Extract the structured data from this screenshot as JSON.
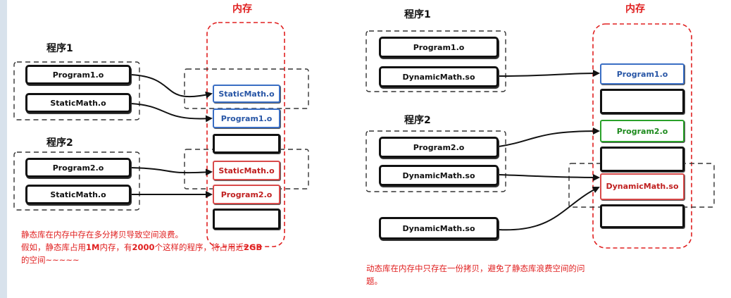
{
  "left": {
    "program1_label": "程序1",
    "program2_label": "程序2",
    "memory_title": "内存",
    "p1_files": [
      "Program1.o",
      "StaticMath.o"
    ],
    "p2_files": [
      "Program2.o",
      "StaticMath.o"
    ],
    "memory_blocks": [
      "StaticMath.o",
      "Program1.o",
      "",
      "StaticMath.o",
      "Program2.o",
      ""
    ],
    "note_line1": "静态库在内存中存在多分拷贝导致空间浪费。",
    "note_line2_a": "假如，静态库占用",
    "note_line2_b": "1M",
    "note_line2_c": "内存，有",
    "note_line2_d": "2000",
    "note_line2_e": "个这样的程序，将占用近",
    "note_line2_f": "2GB",
    "note_line3": "的空间~~~~~"
  },
  "right": {
    "program1_label": "程序1",
    "program2_label": "程序2",
    "memory_title": "内存",
    "p1_files": [
      "Program1.o",
      "DynamicMath.so"
    ],
    "p2_files": [
      "Program2.o",
      "DynamicMath.so"
    ],
    "shared_file": "DynamicMath.so",
    "memory_blocks": [
      "Program1.o",
      "",
      "Program2.o",
      "",
      "DynamicMath.so",
      ""
    ],
    "note_line1": "动态库在内存中只存在一份拷贝，避免了静态库浪费空间的问",
    "note_line2": "题。"
  },
  "colors": {
    "memory_dash": "#e02020",
    "blue": "#3a6ec4",
    "red": "#d84a4a",
    "green": "#2aa12a",
    "note_text": "#e02020"
  }
}
